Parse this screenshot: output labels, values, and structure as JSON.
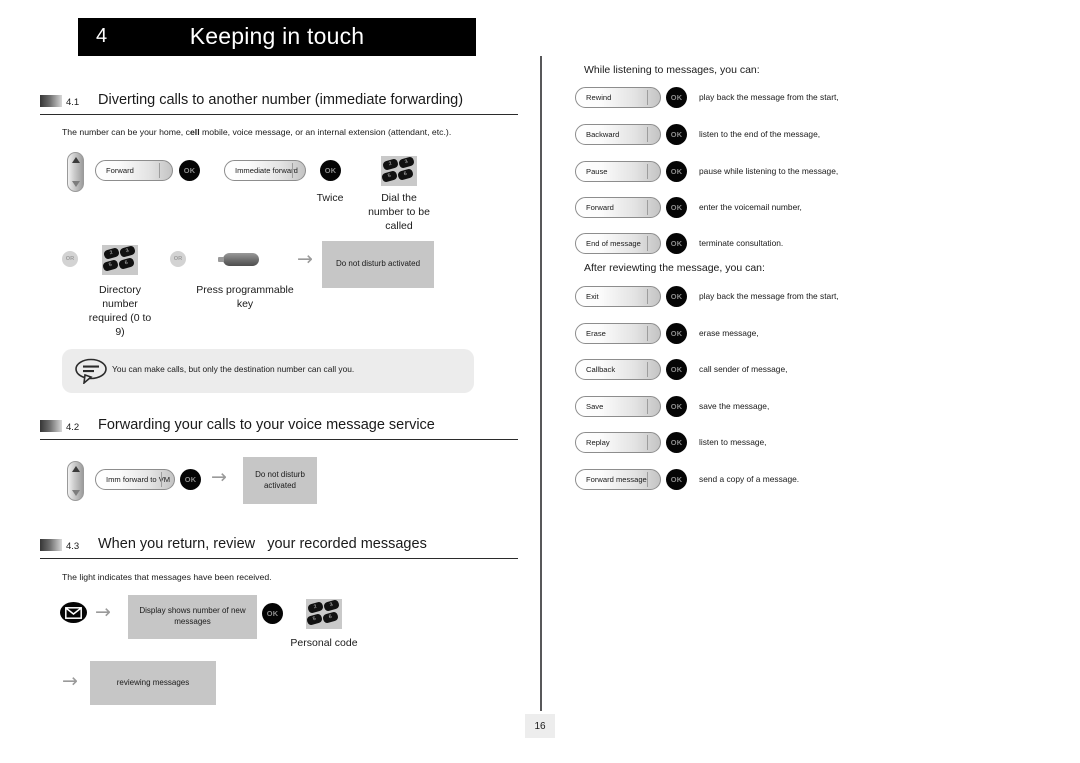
{
  "chapter": {
    "number": "4",
    "title": "Keeping in touch"
  },
  "page_number": "16",
  "sections": [
    {
      "number": "4.1",
      "title": "Diverting calls to another number (immediate forwarding)",
      "intro_before_bold": "The number can be your home, c",
      "intro_bold": "ell",
      "intro_after_bold": " mobile, voice message, or an internal extension (attendant, etc.)."
    },
    {
      "number": "4.2",
      "title": "Forwarding your calls to your voice message service"
    },
    {
      "number": "4.3",
      "title": "When you return, review   your recorded messages",
      "intro": "The light indicates that messages have been received."
    }
  ],
  "flow_41": {
    "navigator_icon": "navigator-icon",
    "softkey_forward": "Forward",
    "ok_1": "OK",
    "softkey_immediate_forward": "Immediate forward",
    "ok_2": "OK",
    "caption_twice": "Twice",
    "keypad_icon": "keypad-icon",
    "caption_dial": "Dial the\nnumber to be\ncalled",
    "or_1": "OR",
    "keypad_icon_2": "keypad-icon",
    "caption_directory": "Directory\nnumber\nrequired (0 to\n9)",
    "or_2": "OR",
    "progkey_icon": "programmable-key-icon",
    "caption_progkey": "Press programmable\nkey",
    "arrow": "→",
    "display_text": "Do not disturb activated"
  },
  "note": {
    "icon": "speech-bubble-icon",
    "text": "You can make calls, but only the destination number can call you."
  },
  "flow_42": {
    "navigator_icon": "navigator-icon",
    "softkey_imm_forward_vm": "Imm forward to VM",
    "ok": "OK",
    "arrow": "→",
    "display_text": "Do not disturb\nactivated"
  },
  "flow_43": {
    "message_icon": "envelope-message-icon",
    "arrow_1": "→",
    "display_text_1": "Display shows number of new\nmessages",
    "ok": "OK",
    "keypad_icon": "keypad-icon",
    "caption_personal_code": "Personal code",
    "arrow_2": "→",
    "display_text_2": "reviewing messages"
  },
  "right_column": {
    "group_listening": {
      "heading": "While listening to messages, you can:",
      "rows": [
        {
          "key": "Rewind",
          "ok": "OK",
          "desc": "play back the message from the start,"
        },
        {
          "key": "Backward",
          "ok": "OK",
          "desc": "listen to the end of the message,"
        },
        {
          "key": "Pause",
          "ok": "OK",
          "desc": "pause while listening to the message,"
        },
        {
          "key": "Forward",
          "ok": "OK",
          "desc": "enter the voicemail number,"
        },
        {
          "key": "End of message",
          "ok": "OK",
          "desc": "terminate consultation."
        }
      ]
    },
    "group_after": {
      "heading": "After reviewting the message, you can:",
      "rows": [
        {
          "key": "Exit",
          "ok": "OK",
          "desc": "play back the message from the start,"
        },
        {
          "key": "Erase",
          "ok": "OK",
          "desc": "erase message,"
        },
        {
          "key": "Callback",
          "ok": "OK",
          "desc": "call sender of message,"
        },
        {
          "key": "Save",
          "ok": "OK",
          "desc": "save the message,"
        },
        {
          "key": "Replay",
          "ok": "OK",
          "desc": "listen to message,"
        },
        {
          "key": "Forward message",
          "ok": "OK",
          "desc": "send a copy of a message."
        }
      ]
    }
  },
  "colors": {
    "banner_bg": "#000000",
    "display_bg": "#c6c6c6",
    "note_bg": "#ececec",
    "divider": "#58585a"
  }
}
